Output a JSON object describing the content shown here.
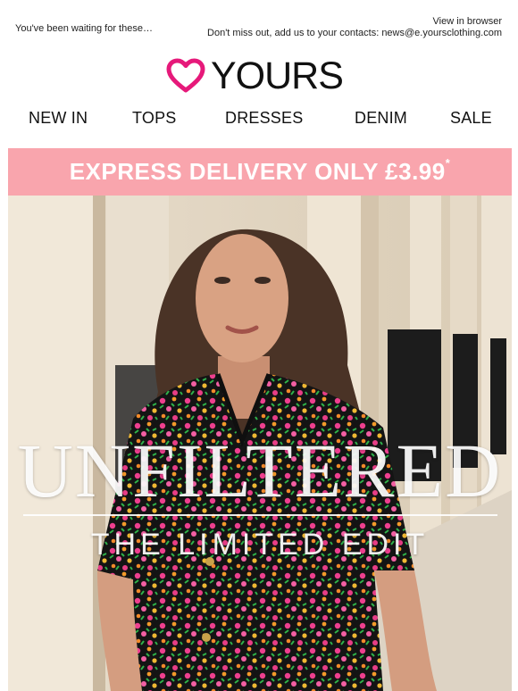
{
  "preheader": {
    "tagline": "You've been waiting for these…",
    "view_in_browser": "View in browser",
    "contacts_note": "Don't miss out, add us to your contacts: news@e.yoursclothing.com"
  },
  "brand": {
    "name": "YOURS",
    "icon": "heart-icon",
    "accent": "#e6197a"
  },
  "nav": {
    "items": [
      "NEW IN",
      "TOPS",
      "DRESSES",
      "DENIM",
      "SALE"
    ]
  },
  "banner": {
    "text": "EXPRESS DELIVERY ONLY £3.99",
    "marker": "*",
    "color": "#f9a5ad"
  },
  "hero": {
    "title": "UNFILTERED",
    "subtitle": "THE LIMITED EDIT"
  }
}
